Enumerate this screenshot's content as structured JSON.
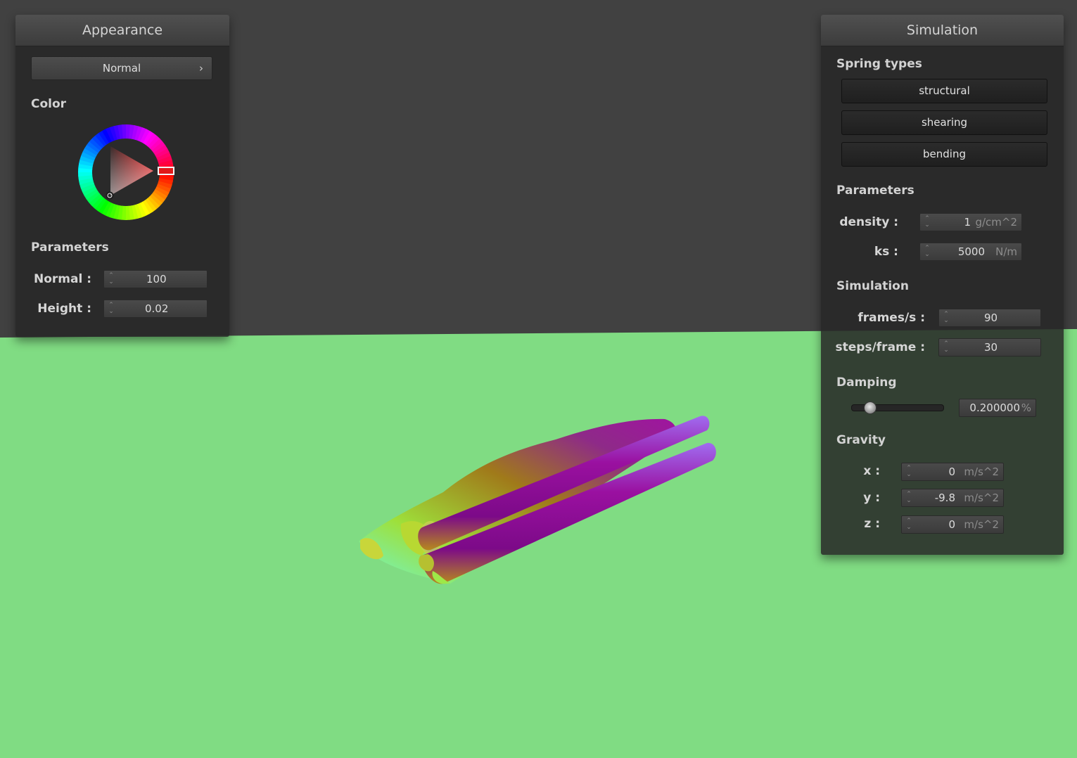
{
  "appearance": {
    "title": "Appearance",
    "mode": "Normal",
    "chevron": "›",
    "color_label": "Color",
    "selected_color": "#cc1111",
    "params_label": "Parameters",
    "fields": [
      {
        "label": "Normal :",
        "value": "100"
      },
      {
        "label": "Height :",
        "value": "0.02"
      }
    ]
  },
  "simulation": {
    "title": "Simulation",
    "spring_types_label": "Spring types",
    "spring_types": [
      "structural",
      "shearing",
      "bending"
    ],
    "params_label": "Parameters",
    "params": [
      {
        "label": "density :",
        "value": "1",
        "unit": "g/cm^2"
      },
      {
        "label": "ks :",
        "value": "5000",
        "unit": "N/m"
      }
    ],
    "sim_label": "Simulation",
    "sim_fields": [
      {
        "label": "frames/s :",
        "value": "90"
      },
      {
        "label": "steps/frame :",
        "value": "30"
      }
    ],
    "damping_label": "Damping",
    "damping_value": "0.200000",
    "damping_unit": "%",
    "damping_fraction": 0.2,
    "gravity_label": "Gravity",
    "gravity": [
      {
        "label": "x :",
        "value": "0",
        "unit": "m/s^2"
      },
      {
        "label": "y :",
        "value": "-9.8",
        "unit": "m/s^2"
      },
      {
        "label": "z :",
        "value": "0",
        "unit": "m/s^2"
      }
    ]
  },
  "scene": {
    "background_color": "#414141",
    "ground_color": "#80dc83",
    "cloth_colors": [
      "#9a0fa4",
      "#c6bb22",
      "#5ff08a"
    ]
  }
}
